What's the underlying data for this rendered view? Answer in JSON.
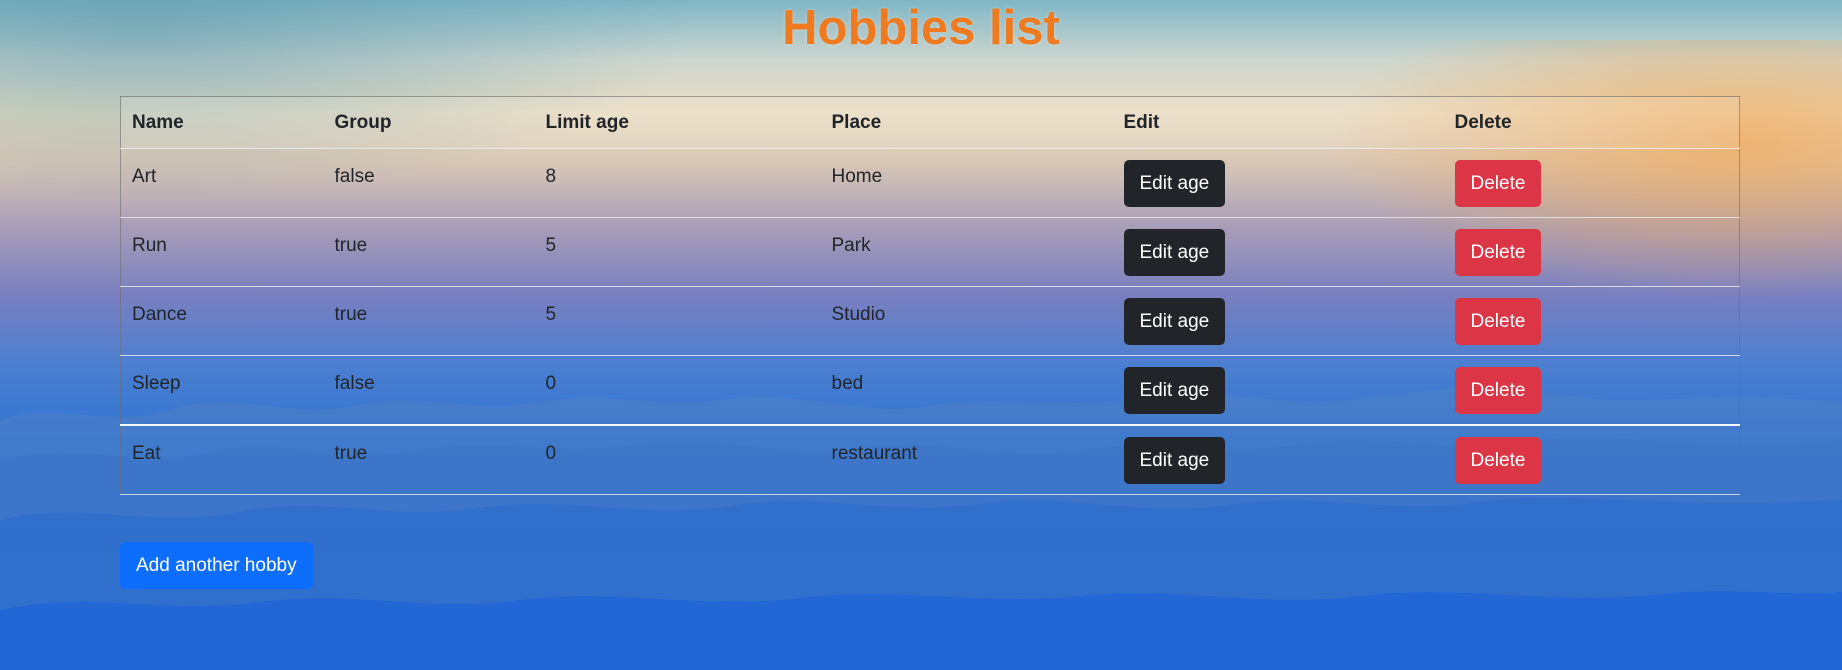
{
  "page": {
    "title": "Hobbies list",
    "title_color": "#f07a1f"
  },
  "table": {
    "headers": {
      "name": "Name",
      "group": "Group",
      "limit_age": "Limit age",
      "place": "Place",
      "edit": "Edit",
      "delete": "Delete"
    },
    "rows": [
      {
        "name": "Art",
        "group": "false",
        "limit_age": "8",
        "place": "Home",
        "edit_label": "Edit age",
        "delete_label": "Delete"
      },
      {
        "name": "Run",
        "group": "true",
        "limit_age": "5",
        "place": "Park",
        "edit_label": "Edit age",
        "delete_label": "Delete"
      },
      {
        "name": "Dance",
        "group": "true",
        "limit_age": "5",
        "place": "Studio",
        "edit_label": "Edit age",
        "delete_label": "Delete"
      },
      {
        "name": "Sleep",
        "group": "false",
        "limit_age": "0",
        "place": "bed",
        "edit_label": "Edit age",
        "delete_label": "Delete"
      },
      {
        "name": "Eat",
        "group": "true",
        "limit_age": "0",
        "place": "restaurant",
        "edit_label": "Edit age",
        "delete_label": "Delete"
      }
    ]
  },
  "actions": {
    "add_label": "Add another hobby"
  },
  "colors": {
    "edit_button": "#212529",
    "delete_button": "#dc3545",
    "add_button": "#0d6efd"
  }
}
